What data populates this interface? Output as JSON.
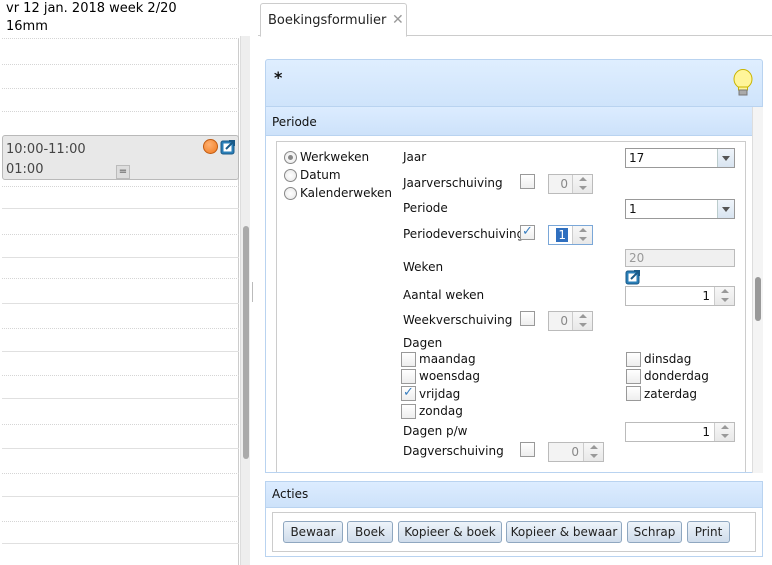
{
  "calendar": {
    "date_line": "vr 12 jan. 2018 week 2/20",
    "zoom": "16mm",
    "appointment": {
      "time": "10:00-11:00",
      "duration": "01:00",
      "eq_label": "="
    }
  },
  "tab": {
    "label": "Boekingsformulier",
    "close": "✕"
  },
  "header": {
    "marker": "*"
  },
  "periode": {
    "title": "Periode",
    "radios": [
      {
        "label": "Werkweken",
        "selected": true
      },
      {
        "label": "Datum",
        "selected": false
      },
      {
        "label": "Kalenderweken",
        "selected": false
      }
    ],
    "jaar": {
      "label": "Jaar",
      "value": "17"
    },
    "jaarverschuiving": {
      "label": "Jaarverschuiving",
      "checked": false,
      "value": "0"
    },
    "periode_field": {
      "label": "Periode",
      "value": "1"
    },
    "periodeverschuiving": {
      "label": "Periodeverschuiving",
      "checked": true,
      "value": "1"
    },
    "weken": {
      "label": "Weken",
      "value": "20"
    },
    "aantal_weken": {
      "label": "Aantal weken",
      "value": "1"
    },
    "weekverschuiving": {
      "label": "Weekverschuiving",
      "checked": false,
      "value": "0"
    },
    "dagen": {
      "label": "Dagen",
      "days": [
        {
          "label": "maandag",
          "checked": false
        },
        {
          "label": "dinsdag",
          "checked": false
        },
        {
          "label": "woensdag",
          "checked": false
        },
        {
          "label": "donderdag",
          "checked": false
        },
        {
          "label": "vrijdag",
          "checked": true
        },
        {
          "label": "zaterdag",
          "checked": false
        },
        {
          "label": "zondag",
          "checked": false
        }
      ]
    },
    "dagen_pw": {
      "label": "Dagen p/w",
      "value": "1"
    },
    "dagverschuiving": {
      "label": "Dagverschuiving",
      "checked": false,
      "value": "0"
    }
  },
  "acties": {
    "title": "Acties",
    "buttons": [
      "Bewaar",
      "Boek",
      "Kopieer & boek",
      "Kopieer & bewaar",
      "Schrap",
      "Print"
    ]
  }
}
